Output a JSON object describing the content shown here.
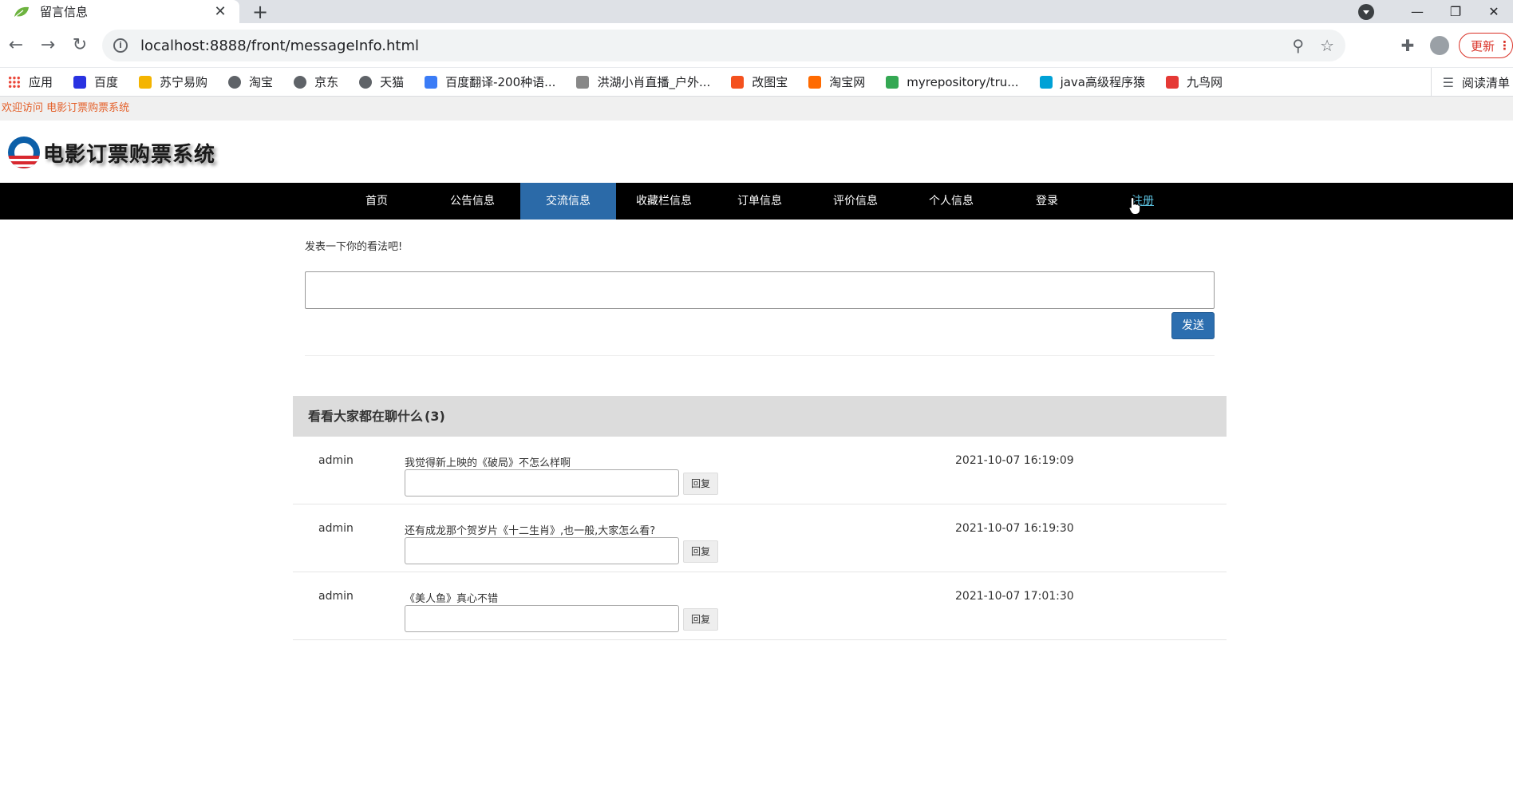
{
  "browser": {
    "tab_title": "留言信息",
    "url": "localhost:8888/front/messageInfo.html",
    "update_label": "更新",
    "reading_list_label": "阅读清单",
    "bookmarks": [
      {
        "label": "应用",
        "color": "#4285f4"
      },
      {
        "label": "百度",
        "color": "#2932e1"
      },
      {
        "label": "苏宁易购",
        "color": "#f4b400"
      },
      {
        "label": "淘宝",
        "color": "#5f6368"
      },
      {
        "label": "京东",
        "color": "#5f6368"
      },
      {
        "label": "天猫",
        "color": "#5f6368"
      },
      {
        "label": "百度翻译-200种语...",
        "color": "#3b7cf6"
      },
      {
        "label": "洪湖小肖直播_户外...",
        "color": "#888888"
      },
      {
        "label": "改图宝",
        "color": "#f4511e"
      },
      {
        "label": "淘宝网",
        "color": "#ff6a00"
      },
      {
        "label": "myrepository/tru...",
        "color": "#34a853"
      },
      {
        "label": "java高级程序猿",
        "color": "#00a1d6"
      },
      {
        "label": "九鸟网",
        "color": "#e53935"
      }
    ]
  },
  "site": {
    "welcome": "欢迎访问 电影订票购票系统",
    "logo_text": "电影订票购票系统"
  },
  "nav": {
    "items": [
      {
        "label": "首页"
      },
      {
        "label": "公告信息"
      },
      {
        "label": "交流信息"
      },
      {
        "label": "收藏栏信息"
      },
      {
        "label": "订单信息"
      },
      {
        "label": "评价信息"
      },
      {
        "label": "个人信息"
      },
      {
        "label": "登录"
      },
      {
        "label": "注册"
      }
    ],
    "active": "交流信息",
    "active_color": "#2b6aa8",
    "hover_color": "#5bc0de"
  },
  "composer": {
    "prompt": "发表一下你的看法吧!",
    "input_value": "",
    "send_label": "发送"
  },
  "thread": {
    "title": "看看大家都在聊什么",
    "count": "(3)",
    "comments": [
      {
        "author": "admin",
        "text": "我觉得新上映的《破局》不怎么样啊",
        "time": "2021-10-07 16:19:09",
        "reply_label": "回复"
      },
      {
        "author": "admin",
        "text": "还有成龙那个贺岁片《十二生肖》,也一般,大家怎么看?",
        "time": "2021-10-07 16:19:30",
        "reply_label": "回复"
      },
      {
        "author": "admin",
        "text": "《美人鱼》真心不错",
        "time": "2021-10-07 17:01:30",
        "reply_label": "回复"
      }
    ]
  }
}
